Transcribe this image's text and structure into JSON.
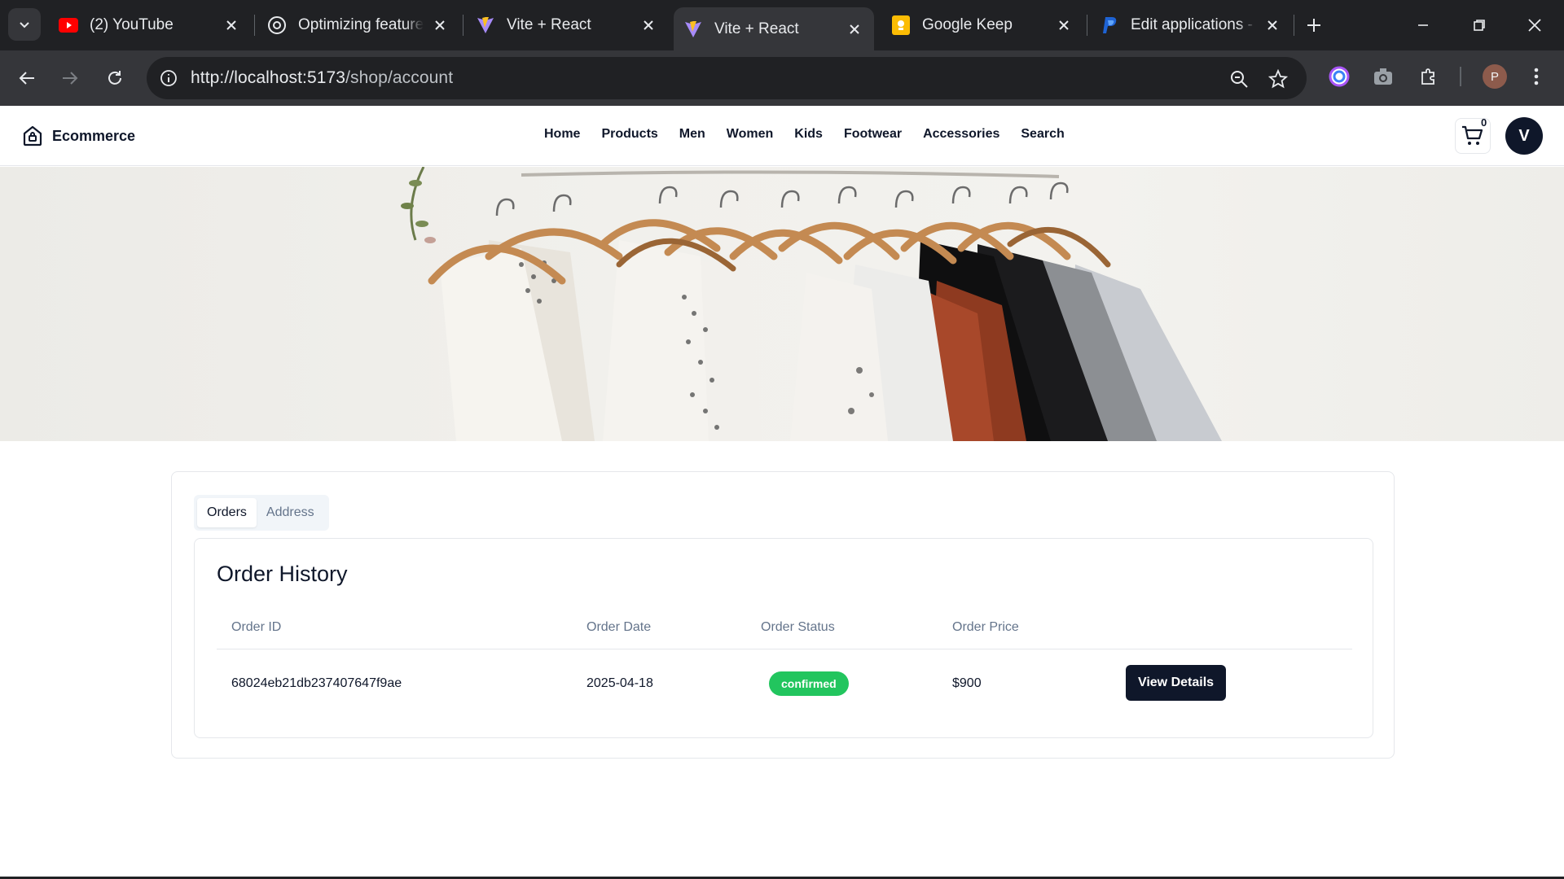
{
  "browser": {
    "tabs": [
      {
        "title": "(2) YouTube",
        "icon": "youtube-icon",
        "active": false
      },
      {
        "title": "Optimizing feature",
        "icon": "chatgpt-icon",
        "active": false
      },
      {
        "title": "Vite + React",
        "icon": "vite-icon",
        "active": false
      },
      {
        "title": "Vite + React",
        "icon": "vite-icon",
        "active": true
      },
      {
        "title": "Google Keep",
        "icon": "keep-icon",
        "active": false
      },
      {
        "title": "Edit applications -",
        "icon": "paypal-icon",
        "active": false
      }
    ],
    "url_host": "http://localhost:5173",
    "url_path": "/shop/account",
    "profile_initial": "P"
  },
  "site": {
    "brand": "Ecommerce",
    "nav": [
      "Home",
      "Products",
      "Men",
      "Women",
      "Kids",
      "Footwear",
      "Accessories",
      "Search"
    ],
    "cart_count": "0",
    "user_initial": "V"
  },
  "account": {
    "tabs": [
      {
        "label": "Orders",
        "active": true
      },
      {
        "label": "Address",
        "active": false
      }
    ],
    "orders_title": "Order History",
    "columns": [
      "Order ID",
      "Order Date",
      "Order Status",
      "Order Price"
    ],
    "orders": [
      {
        "id": "68024eb21db237407647f9ae",
        "date": "2025-04-18",
        "status": "confirmed",
        "price": "$900",
        "action": "View Details"
      }
    ]
  },
  "colors": {
    "chrome_dark": "#202124",
    "chrome_toolbar": "#35363a",
    "primary": "#0f172a",
    "status_confirmed": "#22c55e"
  }
}
